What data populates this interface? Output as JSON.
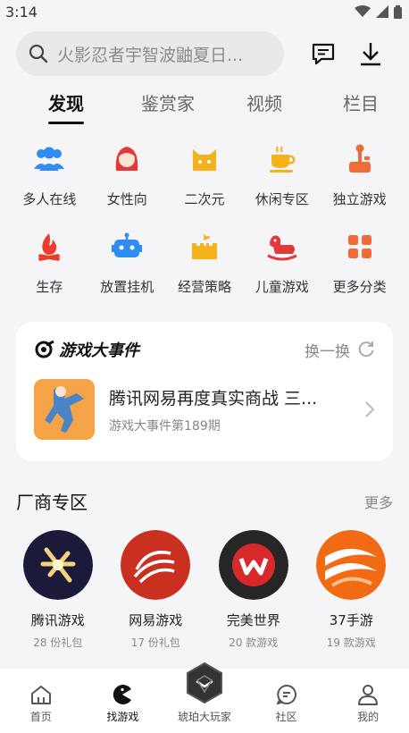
{
  "status": {
    "time": "3:14"
  },
  "search": {
    "placeholder": "火影忍者宇智波鼬夏日..."
  },
  "tabs": [
    {
      "label": "发现"
    },
    {
      "label": "鉴赏家"
    },
    {
      "label": "视频"
    },
    {
      "label": "栏目"
    }
  ],
  "categories": [
    {
      "label": "多人在线",
      "icon": "people-icon",
      "color": "#2f8cf5"
    },
    {
      "label": "女性向",
      "icon": "girl-icon",
      "color": "#e23a3a"
    },
    {
      "label": "二次元",
      "icon": "cat-icon",
      "color": "#f5b21a"
    },
    {
      "label": "休闲专区",
      "icon": "coffee-cup-icon",
      "color": "#f5b21a"
    },
    {
      "label": "独立游戏",
      "icon": "joystick-icon",
      "color": "#f06a3a"
    },
    {
      "label": "生存",
      "icon": "campfire-icon",
      "color": "#ea3d2e"
    },
    {
      "label": "放置挂机",
      "icon": "robot-icon",
      "color": "#2f8cf5"
    },
    {
      "label": "经营策略",
      "icon": "castle-icon",
      "color": "#f5b21a"
    },
    {
      "label": "儿童游戏",
      "icon": "rocking-horse-icon",
      "color": "#e23a3a"
    },
    {
      "label": "更多分类",
      "icon": "grid-icon",
      "color": "#f06a3a"
    }
  ],
  "event": {
    "title": "游戏大事件",
    "refresh": "换一换",
    "name": "腾讯网易再度真实商战 三...",
    "sub": "游戏大事件第189期"
  },
  "vendors_section": {
    "title": "厂商专区",
    "more": "更多"
  },
  "vendors": [
    {
      "name": "腾讯游戏",
      "count": "28 份礼包"
    },
    {
      "name": "网易游戏",
      "count": "17 份礼包"
    },
    {
      "name": "完美世界",
      "count": "20 款游戏"
    },
    {
      "name": "37手游",
      "count": "19 款游戏"
    }
  ],
  "nav": [
    {
      "label": "首页"
    },
    {
      "label": "找游戏"
    },
    {
      "label": "琥珀大玩家"
    },
    {
      "label": "社区"
    },
    {
      "label": "我的"
    }
  ]
}
